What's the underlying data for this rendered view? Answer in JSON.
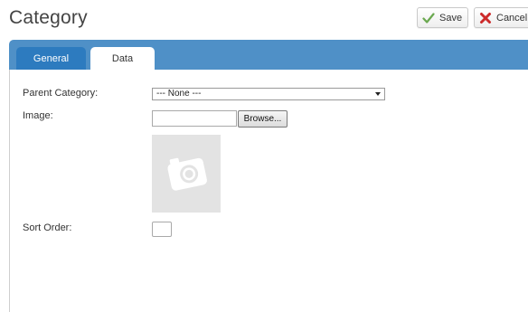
{
  "page": {
    "title": "Category"
  },
  "toolbar": {
    "save_label": "Save",
    "cancel_label": "Cancel",
    "save_icon": "check-icon",
    "cancel_icon": "x-icon",
    "save_icon_color": "#6aa84f",
    "cancel_icon_color": "#cc2a2a"
  },
  "tabs": [
    {
      "label": "General",
      "active": false
    },
    {
      "label": "Data",
      "active": true
    }
  ],
  "form": {
    "parent_category": {
      "label": "Parent Category:",
      "value": "--- None ---"
    },
    "image": {
      "label": "Image:",
      "button_label": "Browse...",
      "value": "",
      "placeholder_icon": "camera-icon"
    },
    "sort_order": {
      "label": "Sort Order:",
      "value": ""
    }
  },
  "colors": {
    "tabbar": "#4f90c7",
    "tab_inactive": "#2d7bbf"
  }
}
